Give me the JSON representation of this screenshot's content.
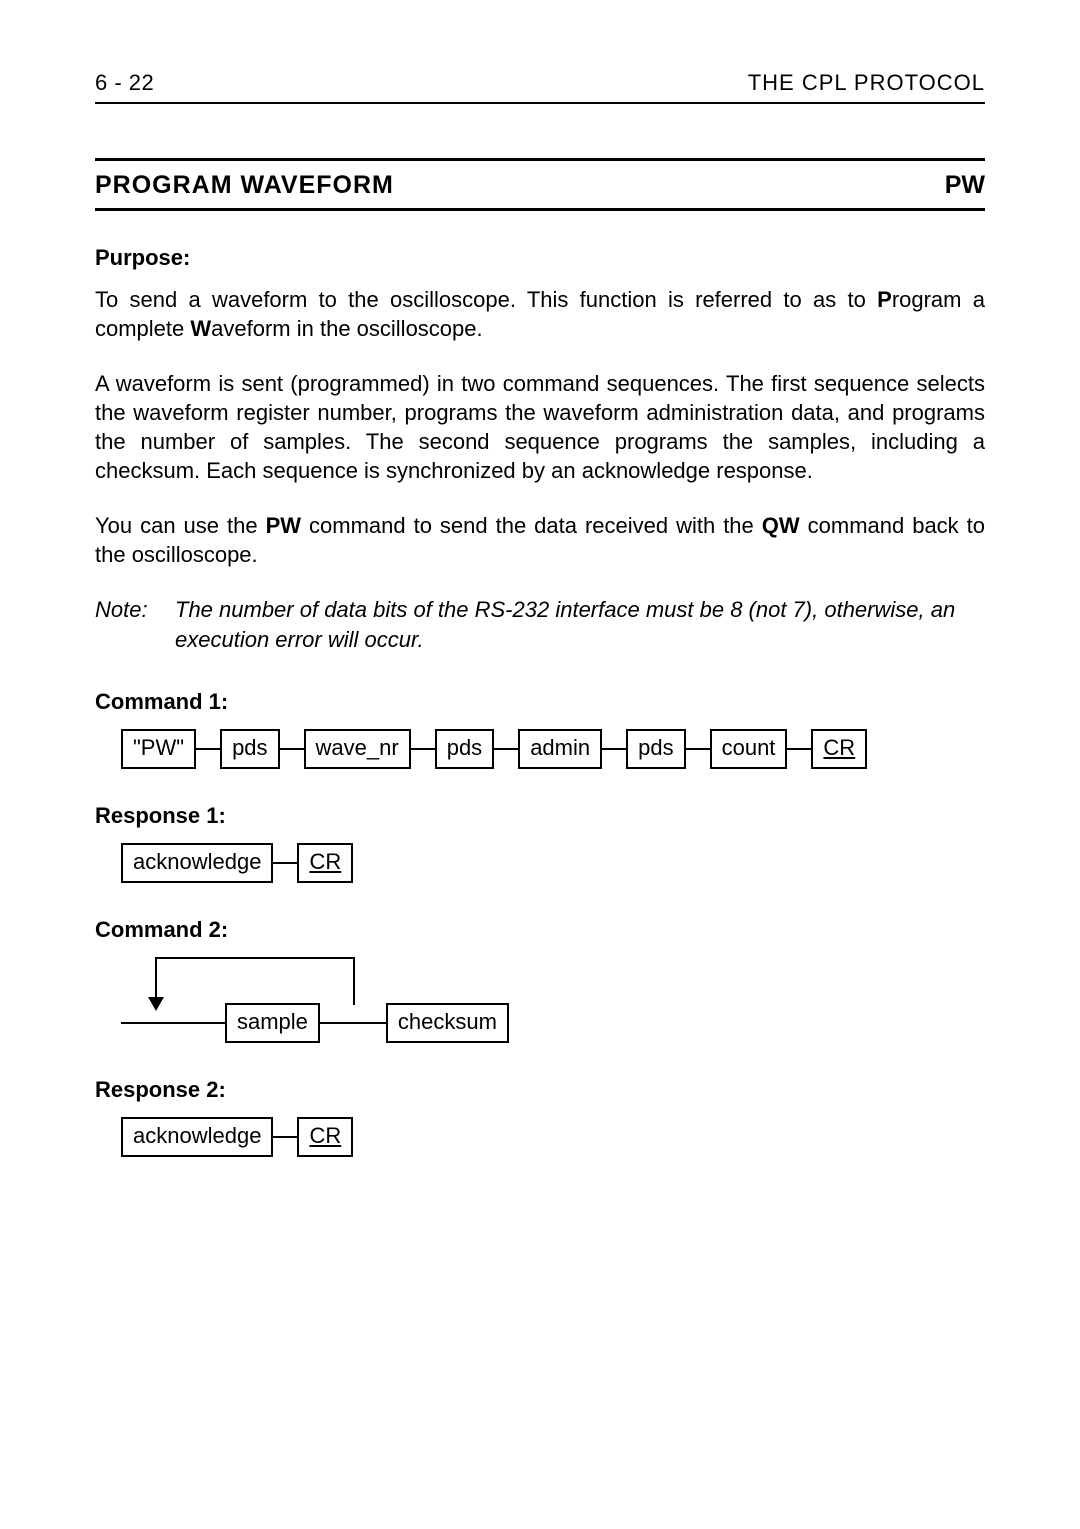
{
  "header": {
    "page_number": "6 - 22",
    "chapter": "THE CPL PROTOCOL"
  },
  "title": {
    "left": "PROGRAM WAVEFORM",
    "right": "PW"
  },
  "sections": {
    "purpose_label": "Purpose:",
    "purpose_p1_a": "To send a waveform to the oscilloscope. This function is referred to as to ",
    "purpose_p1_b": "P",
    "purpose_p1_c": "rogram a complete ",
    "purpose_p1_d": "W",
    "purpose_p1_e": "aveform in the oscilloscope.",
    "purpose_p2": "A waveform is sent (programmed) in two command sequences. The first sequence selects the waveform register number, programs the waveform administration data, and programs the number of samples. The second sequence programs the samples, including a checksum. Each sequence is synchronized by an acknowledge response.",
    "purpose_p3_a": "You can use the ",
    "purpose_p3_b": "PW",
    "purpose_p3_c": " command to send the data received with the ",
    "purpose_p3_d": "QW",
    "purpose_p3_e": " command back to the oscilloscope.",
    "note_label": "Note:",
    "note_body": "The number of data bits of the RS-232 interface must be 8 (not 7), otherwise, an execution error will occur.",
    "command1_label": "Command 1:",
    "response1_label": "Response 1:",
    "command2_label": "Command 2:",
    "response2_label": "Response 2:"
  },
  "syntax": {
    "cmd1": {
      "b0": "\"PW\"",
      "b1": "pds",
      "b2": "wave_nr",
      "b3": "pds",
      "b4": "admin",
      "b5": "pds",
      "b6": "count",
      "b7": "CR"
    },
    "resp1": {
      "b0": "acknowledge",
      "b1": "CR"
    },
    "cmd2": {
      "b0": "sample",
      "b1": "checksum"
    },
    "resp2": {
      "b0": "acknowledge",
      "b1": "CR"
    }
  }
}
